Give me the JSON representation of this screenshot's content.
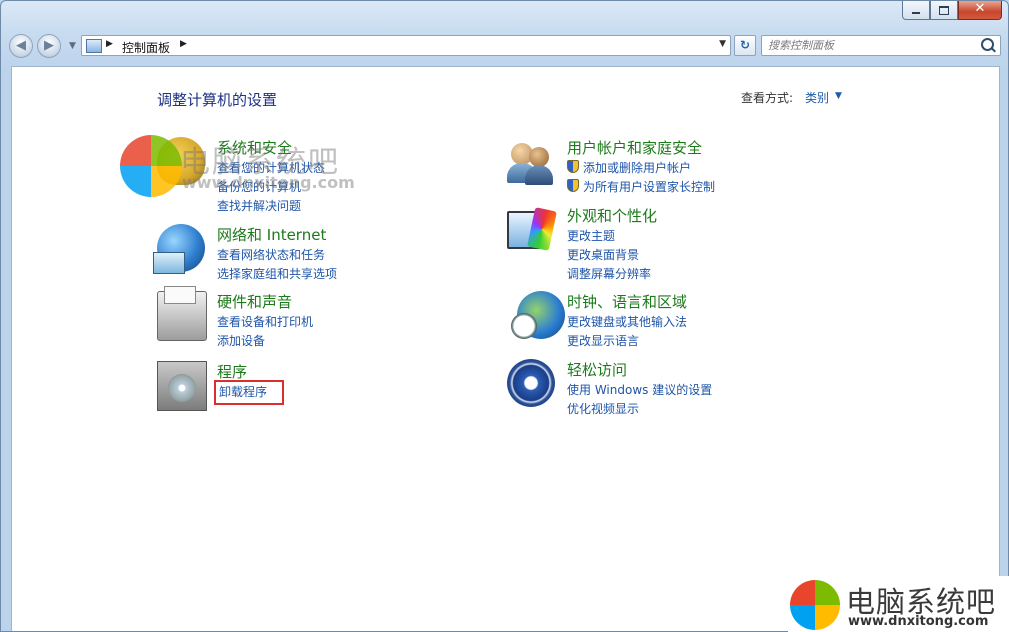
{
  "window": {
    "caption_buttons": {
      "minimize": "—",
      "maximize": "□",
      "close": "✕"
    }
  },
  "nav": {
    "back_icon": "back-arrow-icon",
    "forward_icon": "forward-arrow-icon",
    "breadcrumb": [
      "控制面板"
    ],
    "search_placeholder": "搜索控制面板"
  },
  "header": {
    "page_title": "调整计算机的设置",
    "view_by_label": "查看方式:",
    "view_by_value": "类别"
  },
  "categories": [
    {
      "title": "系统和安全",
      "icon": "system-security-icon",
      "links": [
        "查看您的计算机状态",
        "备份您的计算机",
        "查找并解决问题"
      ]
    },
    {
      "title": "网络和 Internet",
      "icon": "network-internet-icon",
      "links": [
        "查看网络状态和任务",
        "选择家庭组和共享选项"
      ]
    },
    {
      "title": "硬件和声音",
      "icon": "hardware-sound-icon",
      "links": [
        "查看设备和打印机",
        "添加设备"
      ]
    },
    {
      "title": "程序",
      "icon": "programs-icon",
      "links": [
        "卸载程序"
      ],
      "highlighted_link": 0
    },
    {
      "title": "用户帐户和家庭安全",
      "icon": "user-accounts-icon",
      "links": [
        "添加或删除用户帐户",
        "为所有用户设置家长控制"
      ],
      "shield_links": true
    },
    {
      "title": "外观和个性化",
      "icon": "appearance-icon",
      "links": [
        "更改主题",
        "更改桌面背景",
        "调整屏幕分辨率"
      ]
    },
    {
      "title": "时钟、语言和区域",
      "icon": "clock-language-region-icon",
      "links": [
        "更改键盘或其他输入法",
        "更改显示语言"
      ]
    },
    {
      "title": "轻松访问",
      "icon": "ease-of-access-icon",
      "links": [
        "使用 Windows 建议的设置",
        "优化视频显示"
      ]
    }
  ],
  "watermarks": {
    "overlay": {
      "text": "电脑系统吧",
      "url": "www.dnxitong.com"
    },
    "corner": {
      "text": "电脑系统吧",
      "url": "www.dnxitong.com"
    },
    "logo_colors": [
      "#e8452c",
      "#7cbb00",
      "#00a1f1",
      "#ffbb00"
    ]
  },
  "colors": {
    "category_title": "#1d7a1b",
    "link": "#1e55a8",
    "page_title": "#1e3287",
    "highlight_box": "#d82f2f"
  }
}
